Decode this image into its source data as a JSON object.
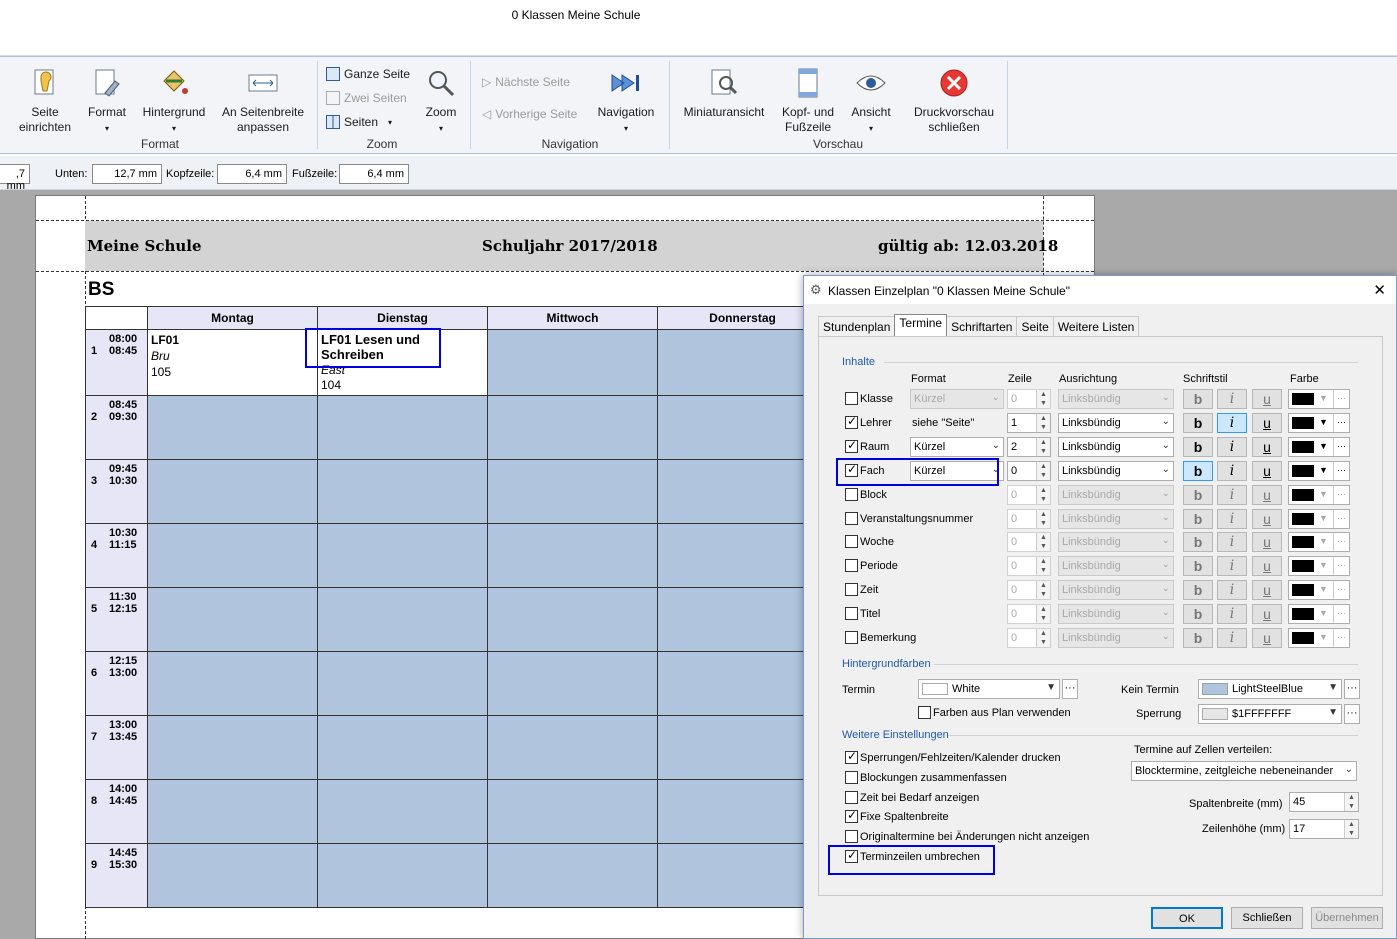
{
  "window": {
    "title": "0 Klassen Meine Schule"
  },
  "ribbon": {
    "seite_einrichten": "Seite\neinrichten",
    "format": "Format",
    "hintergrund": "Hintergrund",
    "seitenbreite": "An Seitenbreite\nanpassen",
    "group_format": "Format",
    "ganze_seite": "Ganze Seite",
    "zwei_seiten": "Zwei Seiten",
    "seiten": "Seiten",
    "zoom": "Zoom",
    "group_zoom": "Zoom",
    "naechste_seite": "Nächste Seite",
    "vorherige_seite": "Vorherige Seite",
    "navigation": "Navigation",
    "group_navigation": "Navigation",
    "miniaturansicht": "Miniaturansicht",
    "kopf_fusszeile": "Kopf- und\nFußzeile",
    "ansicht": "Ansicht",
    "druckvorschau": "Druckvorschau\nschließen",
    "group_vorschau": "Vorschau"
  },
  "margins": {
    "left_value": ",7 mm",
    "unten_label": "Unten:",
    "unten_value": "12,7 mm",
    "kopf_label": "Kopfzeile:",
    "kopf_value": "6,4 mm",
    "fuss_label": "Fußzeile:",
    "fuss_value": "6,4 mm"
  },
  "page": {
    "school": "Meine Schule",
    "year": "Schuljahr 2017/2018",
    "valid": "gültig ab: 12.03.2018",
    "class": "BS",
    "days": [
      "Montag",
      "Dienstag",
      "Mittwoch",
      "Donnerstag"
    ],
    "periods": [
      {
        "n": "1",
        "from": "08:00",
        "to": "08:45"
      },
      {
        "n": "2",
        "from": "08:45",
        "to": "09:30"
      },
      {
        "n": "3",
        "from": "09:45",
        "to": "10:30"
      },
      {
        "n": "4",
        "from": "10:30",
        "to": "11:15"
      },
      {
        "n": "5",
        "from": "11:30",
        "to": "12:15"
      },
      {
        "n": "6",
        "from": "12:15",
        "to": "13:00"
      },
      {
        "n": "7",
        "from": "13:00",
        "to": "13:45"
      },
      {
        "n": "8",
        "from": "14:00",
        "to": "14:45"
      },
      {
        "n": "9",
        "from": "14:45",
        "to": "15:30"
      }
    ],
    "mon": {
      "subject": "LF01",
      "teacher": "Bru",
      "room": "105"
    },
    "tue": {
      "subject": "LF01 Lesen und Schreiben",
      "teacher": "East",
      "room": "104"
    }
  },
  "dialog": {
    "title": "Klassen Einzelplan \"0 Klassen Meine Schule\"",
    "tabs": [
      "Stundenplan",
      "Termine",
      "Schriftarten",
      "Seite",
      "Weitere Listen"
    ],
    "inhalte": "Inhalte",
    "col_format": "Format",
    "col_zeile": "Zeile",
    "col_ausrichtung": "Ausrichtung",
    "col_schriftstil": "Schriftstil",
    "col_farbe": "Farbe",
    "rows": [
      {
        "label": "Klasse",
        "checked": false,
        "format": "Kürzel",
        "format_enabled": false,
        "zeile": "0",
        "align": "Linksbündig",
        "enabled": false
      },
      {
        "label": "Lehrer",
        "checked": true,
        "format": "siehe \"Seite\"",
        "format_enabled": true,
        "zeile": "1",
        "align": "Linksbündig",
        "enabled": true
      },
      {
        "label": "Raum",
        "checked": true,
        "format": "Kürzel",
        "format_enabled": true,
        "zeile": "2",
        "align": "Linksbündig",
        "enabled": true
      },
      {
        "label": "Fach",
        "checked": true,
        "format": "Kürzel",
        "format_enabled": true,
        "zeile": "0",
        "align": "Linksbündig",
        "enabled": true
      },
      {
        "label": "Block",
        "checked": false,
        "format": "",
        "format_enabled": false,
        "zeile": "0",
        "align": "Linksbündig",
        "enabled": false
      },
      {
        "label": "Veranstaltungsnummer",
        "checked": false,
        "format": "",
        "format_enabled": false,
        "zeile": "0",
        "align": "Linksbündig",
        "enabled": false
      },
      {
        "label": "Woche",
        "checked": false,
        "format": "",
        "format_enabled": false,
        "zeile": "0",
        "align": "Linksbündig",
        "enabled": false
      },
      {
        "label": "Periode",
        "checked": false,
        "format": "",
        "format_enabled": false,
        "zeile": "0",
        "align": "Linksbündig",
        "enabled": false
      },
      {
        "label": "Zeit",
        "checked": false,
        "format": "",
        "format_enabled": false,
        "zeile": "0",
        "align": "Linksbündig",
        "enabled": false
      },
      {
        "label": "Titel",
        "checked": false,
        "format": "",
        "format_enabled": false,
        "zeile": "0",
        "align": "Linksbündig",
        "enabled": false
      },
      {
        "label": "Bemerkung",
        "checked": false,
        "format": "",
        "format_enabled": false,
        "zeile": "0",
        "align": "Linksbündig",
        "enabled": false
      }
    ],
    "bold_glyph": "b",
    "italic_glyph": "i",
    "underline_glyph": "u",
    "more_glyph": "···",
    "hintergrundfarben": "Hintergrundfarben",
    "termin_label": "Termin",
    "termin_color": "White",
    "kein_termin_label": "Kein Termin",
    "kein_termin_color": "LightSteelBlue",
    "farben_aus_plan": "Farben aus Plan verwenden",
    "sperrung_label": "Sperrung",
    "sperrung_color": "$1FFFFFFF",
    "weitere": "Weitere Einstellungen",
    "options": [
      {
        "label": "Sperrungen/Fehlzeiten/Kalender drucken",
        "checked": true
      },
      {
        "label": "Blockungen zusammenfassen",
        "checked": false
      },
      {
        "label": "Zeit bei Bedarf anzeigen",
        "checked": false
      },
      {
        "label": "Fixe Spaltenbreite",
        "checked": true
      },
      {
        "label": "Originaltermine bei Änderungen nicht anzeigen",
        "checked": false
      },
      {
        "label": "Terminzeilen umbrechen",
        "checked": true
      }
    ],
    "verteilen_label": "Termine auf Zellen verteilen:",
    "verteilen_value": "Blocktermine, zeitgleiche nebeneinander",
    "spaltenbreite_label": "Spaltenbreite (mm)",
    "spaltenbreite": "45",
    "zeilenhoehe_label": "Zeilenhöhe (mm)",
    "zeilenhoehe": "17",
    "ok": "OK",
    "schliessen": "Schließen",
    "uebernehmen": "Übernehmen"
  },
  "colors": {
    "lightsteelblue": "#B0C4DE",
    "header_band": "#D3D3D3",
    "highlight": "#0000E0"
  }
}
